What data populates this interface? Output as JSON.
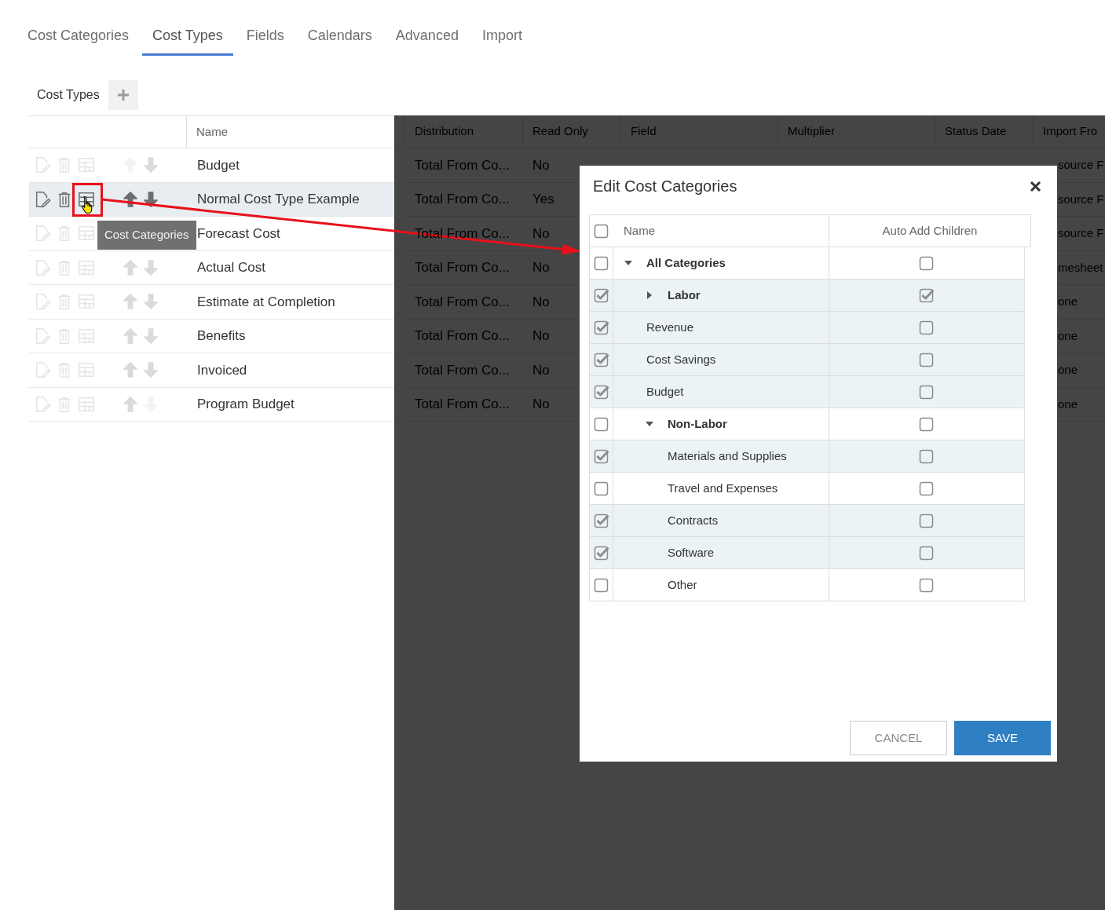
{
  "tabs": [
    {
      "label": "Cost Categories",
      "selected": false
    },
    {
      "label": "Cost Types",
      "selected": true
    },
    {
      "label": "Fields",
      "selected": false
    },
    {
      "label": "Calendars",
      "selected": false
    },
    {
      "label": "Advanced",
      "selected": false
    },
    {
      "label": "Import",
      "selected": false
    }
  ],
  "toolbar": {
    "title": "Cost Types"
  },
  "table": {
    "columns": [
      "Name",
      "Distribution",
      "Read Only",
      "Field",
      "Multiplier",
      "Status Date",
      "Import Fro"
    ],
    "rows": [
      {
        "name": "Budget",
        "distribution": "Total From Co...",
        "read_only": "No",
        "column_7": "source F",
        "selected": false,
        "can_move_up": false,
        "can_move_down": true
      },
      {
        "name": "Normal Cost Type Example",
        "distribution": "Total From Co...",
        "read_only": "Yes",
        "column_7": "source F",
        "selected": true,
        "can_move_up": true,
        "can_move_down": true
      },
      {
        "name": "Forecast Cost",
        "distribution": "Total From Co...",
        "read_only": "No",
        "column_7": "source F",
        "selected": false
      },
      {
        "name": "Actual Cost",
        "distribution": "Total From Co...",
        "read_only": "No",
        "column_7": "mesheet",
        "selected": false,
        "can_move_up": true,
        "can_move_down": true
      },
      {
        "name": "Estimate at Completion",
        "distribution": "Total From Co...",
        "read_only": "No",
        "column_7": "one",
        "selected": false,
        "can_move_up": true,
        "can_move_down": true
      },
      {
        "name": "Benefits",
        "distribution": "Total From Co...",
        "read_only": "No",
        "column_7": "one",
        "selected": false,
        "can_move_up": true,
        "can_move_down": true
      },
      {
        "name": "Invoiced",
        "distribution": "Total From Co...",
        "read_only": "No",
        "column_7": "one",
        "selected": false,
        "can_move_up": true,
        "can_move_down": true
      },
      {
        "name": "Program Budget",
        "distribution": "Total From Co...",
        "read_only": "No",
        "column_7": "one",
        "selected": false,
        "can_move_up": true,
        "can_move_down": false
      }
    ]
  },
  "tooltip": {
    "text": "Cost Categories"
  },
  "modal": {
    "title": "Edit Cost Categories",
    "select_all": false,
    "columns": [
      "Name",
      "Auto Add Children"
    ],
    "categories": [
      {
        "name": "All Categories",
        "checked": false,
        "auto_add_children": false,
        "expanded": true,
        "children": [
          {
            "name": "Labor",
            "checked": true,
            "auto_add_children": true,
            "expanded": false
          },
          {
            "name": "Revenue",
            "checked": true,
            "auto_add_children": false
          },
          {
            "name": "Cost Savings",
            "checked": true,
            "auto_add_children": false
          },
          {
            "name": "Budget",
            "checked": true,
            "auto_add_children": false
          },
          {
            "name": "Non-Labor",
            "checked": false,
            "auto_add_children": false,
            "expanded": true,
            "children": [
              {
                "name": "Materials and Supplies",
                "checked": true,
                "auto_add_children": false
              },
              {
                "name": "Travel and Expenses",
                "checked": false,
                "auto_add_children": false
              },
              {
                "name": "Contracts",
                "checked": true,
                "auto_add_children": false
              },
              {
                "name": "Software",
                "checked": true,
                "auto_add_children": false
              },
              {
                "name": "Other",
                "checked": false,
                "auto_add_children": false
              }
            ]
          }
        ]
      }
    ],
    "buttons": [
      {
        "label": "CANCEL",
        "kind": "secondary"
      },
      {
        "label": "SAVE",
        "kind": "primary"
      }
    ]
  }
}
